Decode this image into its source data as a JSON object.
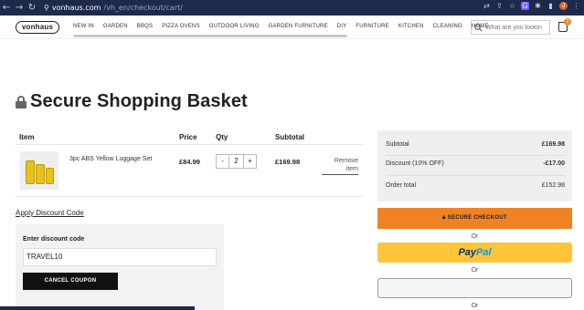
{
  "browser": {
    "back": "←",
    "forward": "→",
    "reload": "↻",
    "url_host": "vonhaus.com",
    "url_path": "/vh_en/checkout/cart/",
    "profile_initial": "J"
  },
  "header": {
    "logo": "vonhaus",
    "menu": [
      "NEW IN",
      "GARDEN",
      "BBQS",
      "PIZZA OVENS",
      "OUTDOOR LIVING",
      "GARDEN FURNITURE",
      "DIY",
      "FURNITURE",
      "KITCHEN",
      "CLEANING",
      "HOME"
    ],
    "search_placeholder": "What are you lookin",
    "cart_count": "2"
  },
  "page_title": "Secure Shopping Basket",
  "table": {
    "col_item": "Item",
    "col_price": "Price",
    "col_qty": "Qty",
    "col_subtotal": "Subtotal",
    "row": {
      "name": "3pc ABS Yellow Luggage Set",
      "price": "£84.99",
      "qty": "2",
      "subtotal": "£169.98",
      "remove": "Remove item",
      "minus": "-",
      "plus": "+"
    }
  },
  "discount": {
    "link": "Apply Discount Code",
    "label": "Enter discount code",
    "value": "TRAVEL10",
    "button": "CANCEL COUPON"
  },
  "summary": {
    "subtotal_label": "Subtotal",
    "subtotal_value": "£169.98",
    "discount_label": "Discount (10% OFF)",
    "discount_value": "-£17.00",
    "total_label": "Order total",
    "total_value": "£152.98",
    "checkout": "SECURE CHECKOUT",
    "or": "Or",
    "paypal_a": "Pay",
    "paypal_b": "Pal"
  },
  "colors": {
    "checkout": "#f08224",
    "paypal": "#ffc439",
    "chrome": "#1d2a4a"
  }
}
